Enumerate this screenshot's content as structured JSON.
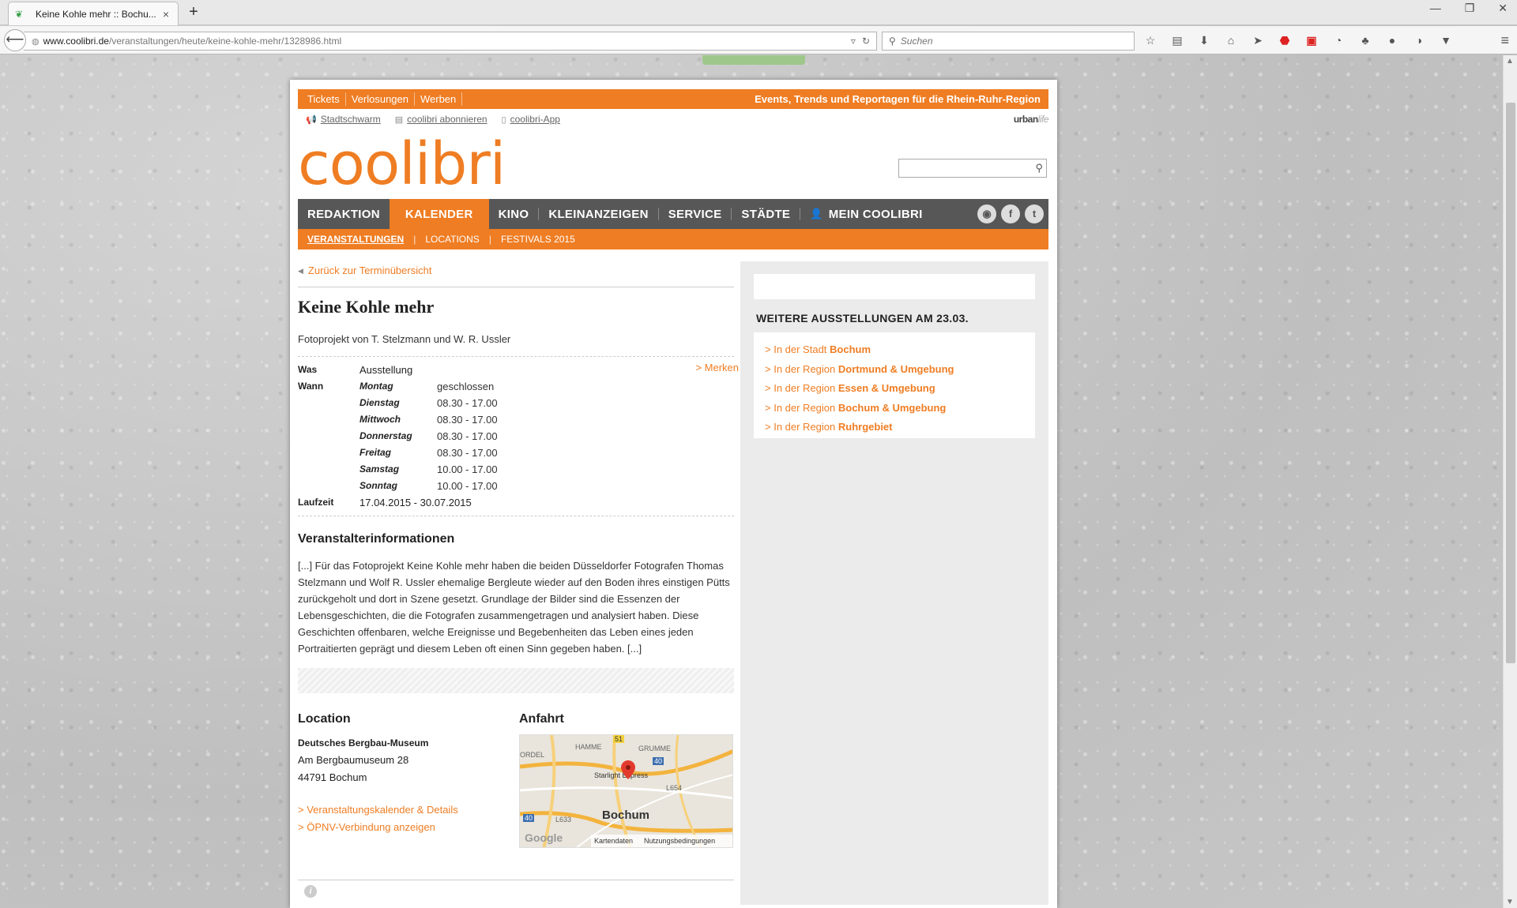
{
  "browser": {
    "tab_title": "Keine Kohle mehr :: Bochu...",
    "tab_close": "×",
    "new_tab": "+",
    "url_domain": "www.coolibri.de",
    "url_path": "/veranstaltungen/heute/keine-kohle-mehr/1328986.html",
    "search_placeholder": "Suchen",
    "win_min": "—",
    "win_restore": "❐",
    "win_close": "✕"
  },
  "site": {
    "top_links": [
      "Tickets",
      "Verlosungen",
      "Werben"
    ],
    "tagline": "Events, Trends und Reportagen für die Rhein-Ruhr-Region",
    "sub_links": [
      "Stadtschwarm",
      "coolibri abonnieren",
      "coolibri-App"
    ],
    "urbanlife_a": "urban",
    "urbanlife_b": "life",
    "logo": "coolibri",
    "main_nav": [
      "REDAKTION",
      "KALENDER",
      "KINO",
      "KLEINANZEIGEN",
      "SERVICE",
      "STÄDTE",
      "MEIN COOLIBRI"
    ],
    "sec_nav": [
      "VERANSTALTUNGEN",
      "LOCATIONS",
      "FESTIVALS 2015"
    ]
  },
  "event": {
    "back_link": "Zurück zur Terminübersicht",
    "title": "Keine Kohle mehr",
    "subtitle": "Fotoprojekt von T. Stelzmann und W. R. Ussler",
    "was_label": "Was",
    "was_value": "Ausstellung",
    "merken": "> Merken",
    "wann_label": "Wann",
    "hours": [
      {
        "day": "Montag",
        "time": "geschlossen"
      },
      {
        "day": "Dienstag",
        "time": "08.30 - 17.00"
      },
      {
        "day": "Mittwoch",
        "time": "08.30 - 17.00"
      },
      {
        "day": "Donnerstag",
        "time": "08.30 - 17.00"
      },
      {
        "day": "Freitag",
        "time": "08.30 - 17.00"
      },
      {
        "day": "Samstag",
        "time": "10.00 - 17.00"
      },
      {
        "day": "Sonntag",
        "time": "10.00 - 17.00"
      }
    ],
    "laufzeit_label": "Laufzeit",
    "laufzeit_value": "17.04.2015 - 30.07.2015",
    "organizer_head": "Veranstalterinformationen",
    "description": "[...] Für das Fotoprojekt Keine Kohle mehr haben die beiden Düsseldorfer Fotografen Thomas Stelzmann und Wolf R. Ussler ehemalige Bergleute wieder auf den Boden ihres einstigen Pütts zurückgeholt und dort in Szene gesetzt. Grundlage der Bilder sind die Essenzen der Lebensgeschichten, die die Fotografen zusammengetragen und analysiert haben. Diese Geschichten offenbaren, welche Ereignisse und Begebenheiten das Leben eines jeden Portraitierten geprägt und diesem Leben oft einen Sinn gegeben haben. [...]"
  },
  "location": {
    "head": "Location",
    "name": "Deutsches Bergbau-Museum",
    "street": "Am Bergbaumuseum 28",
    "city": "44791 Bochum",
    "link1": "> Veranstaltungskalender & Details",
    "link2": "> ÖPNV-Verbindung anzeigen"
  },
  "anfahrt": {
    "head": "Anfahrt",
    "map_labels": [
      "HAMME",
      "GRUMME",
      "ORDEL",
      "Starlight Express",
      "L654",
      "L633"
    ],
    "map_city": "Bochum",
    "road_51": "51",
    "road_40a": "40",
    "road_40b": "40",
    "map_footer": [
      "Kartendaten",
      "Nutzungsbedingungen"
    ],
    "google": "Google"
  },
  "sidebar": {
    "head": "WEITERE AUSSTELLUNGEN AM 23.03.",
    "items": [
      {
        "prefix": "> In der Stadt ",
        "place": "Bochum"
      },
      {
        "prefix": "> In der Region ",
        "place": "Dortmund & Umgebung"
      },
      {
        "prefix": "> In der Region ",
        "place": "Essen & Umgebung"
      },
      {
        "prefix": "> In der Region ",
        "place": "Bochum & Umgebung"
      },
      {
        "prefix": "> In der Region ",
        "place": "Ruhrgebiet"
      }
    ]
  },
  "footer": {
    "info_icon": "i"
  },
  "colors": {
    "orange": "#ef7d23",
    "navgray": "#575757"
  }
}
